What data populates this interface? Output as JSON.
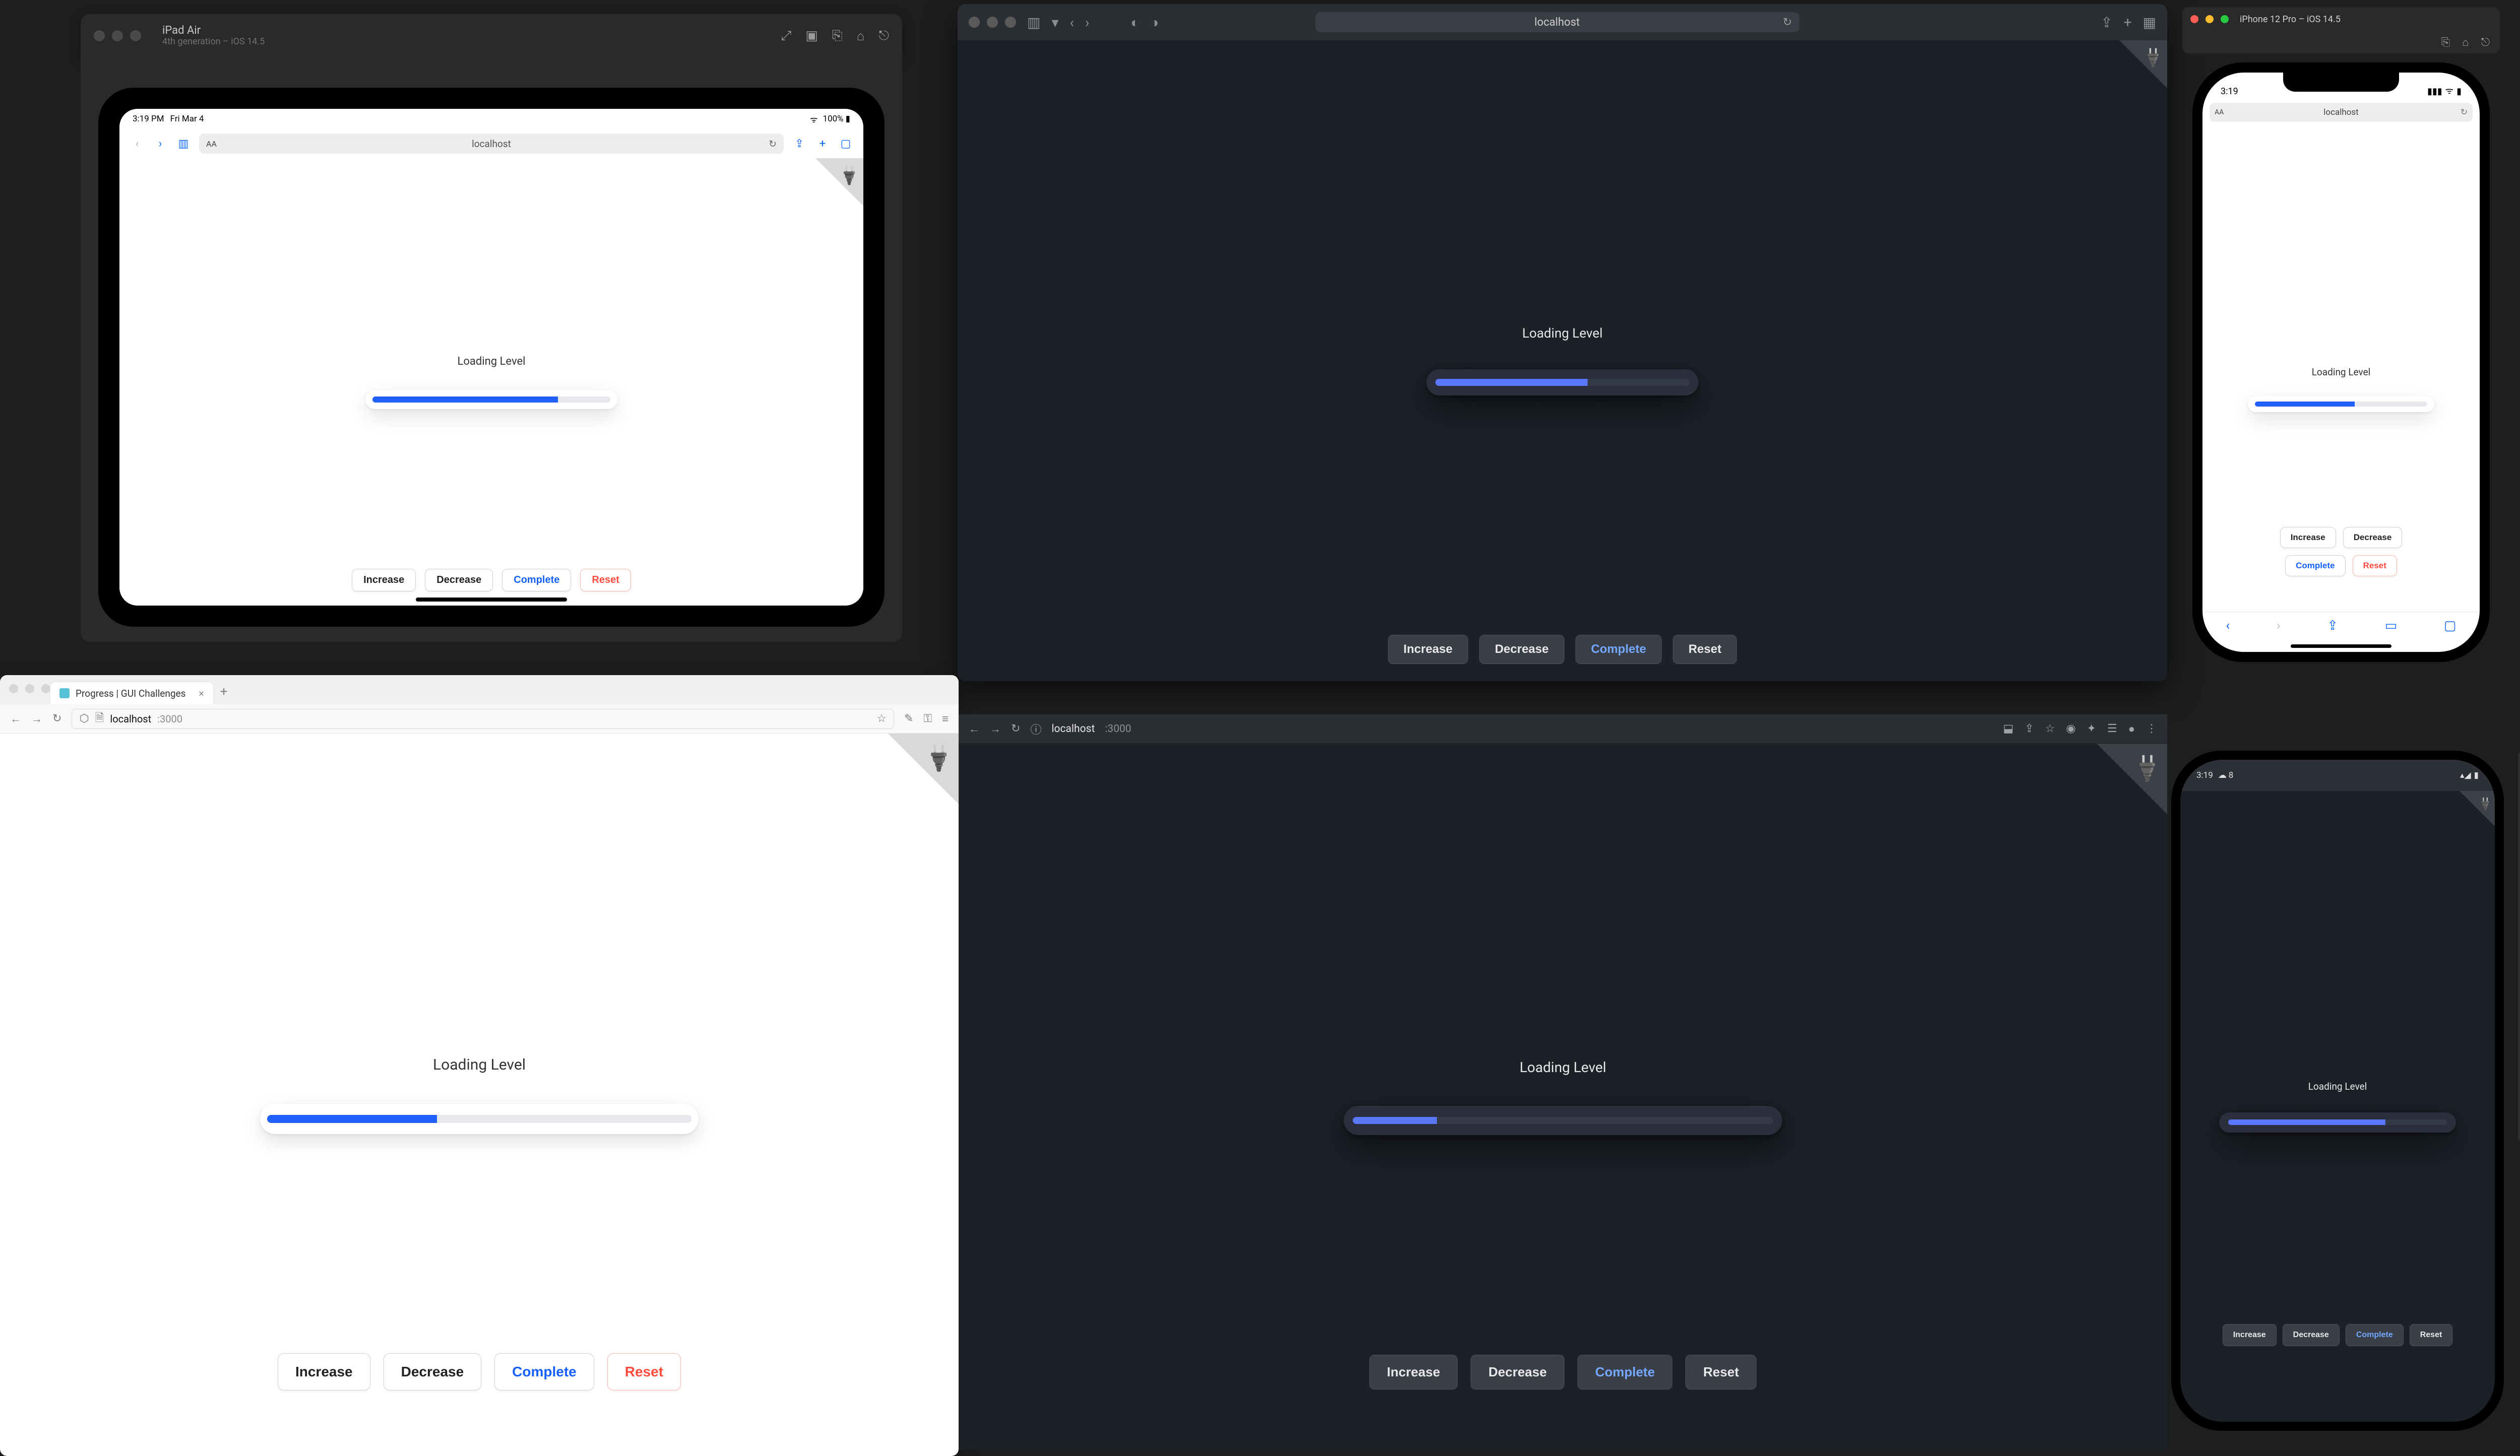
{
  "app": {
    "loading_label": "Loading Level",
    "buttons": {
      "increase": "Increase",
      "decrease": "Decrease",
      "complete": "Complete",
      "reset": "Reset"
    }
  },
  "ipad": {
    "title": "iPad Air",
    "subtitle": "4th generation – iOS 14.5",
    "status_time": "3:19 PM",
    "status_date": "Fri Mar 4",
    "battery": "100%",
    "url": "localhost",
    "progress_pct": 78
  },
  "safari": {
    "url": "localhost",
    "progress_pct": 60
  },
  "iphone": {
    "title": "iPhone 12 Pro – iOS 14.5",
    "status_time": "3:19",
    "url": "localhost",
    "progress_pct": 58
  },
  "firefox": {
    "tab_title": "Progress | GUI Challenges",
    "host": "localhost",
    "port": ":3000",
    "progress_pct": 40
  },
  "chrome": {
    "host": "localhost",
    "port": ":3000",
    "progress_pct": 20
  },
  "android": {
    "status_time": "3:19",
    "status_temp": "8",
    "progress_pct": 72
  }
}
